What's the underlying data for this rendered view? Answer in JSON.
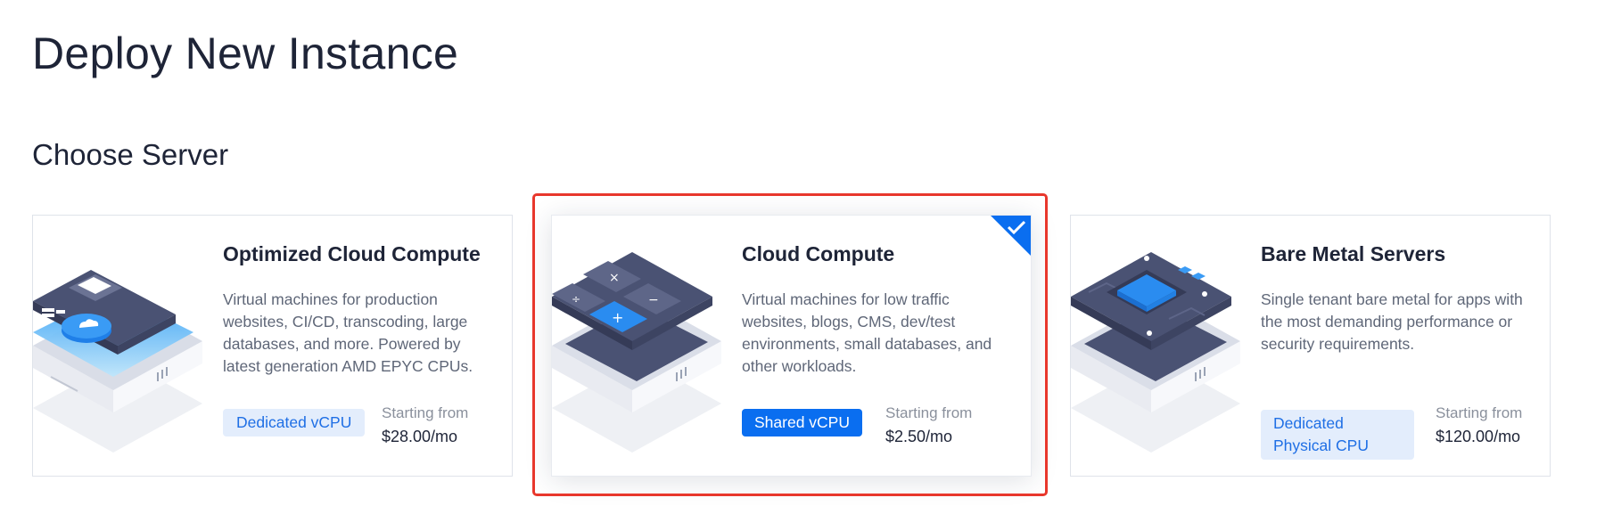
{
  "page": {
    "title": "Deploy New Instance",
    "section_title": "Choose Server"
  },
  "cards": [
    {
      "title": "Optimized Cloud Compute",
      "description": "Virtual machines for production websites, CI/CD, transcoding, large databases, and more. Powered by latest generation AMD EPYC CPUs.",
      "tag": "Dedicated vCPU",
      "price_label": "Starting from",
      "price": "$28.00/mo",
      "selected": false,
      "icon": "cpu-chip-illustration"
    },
    {
      "title": "Cloud Compute",
      "description": "Virtual machines for low traffic websites, blogs, CMS, dev/test environments, small databases, and other workloads.",
      "tag": "Shared vCPU",
      "price_label": "Starting from",
      "price": "$2.50/mo",
      "selected": true,
      "icon": "calculator-illustration"
    },
    {
      "title": "Bare Metal Servers",
      "description": "Single tenant bare metal for apps with the most demanding performance or security requirements.",
      "tag": "Dedicated Physical CPU",
      "price_label": "Starting from",
      "price": "$120.00/mo",
      "selected": false,
      "icon": "bare-metal-chip-illustration"
    }
  ],
  "colors": {
    "accent": "#0a6ef0",
    "selection_outline": "#e8372c",
    "tag_light_bg": "#e3edfc",
    "tag_light_text": "#1f6fe5",
    "illustration_dark": "#454d6e",
    "illustration_blue": "#2a8cf0"
  }
}
